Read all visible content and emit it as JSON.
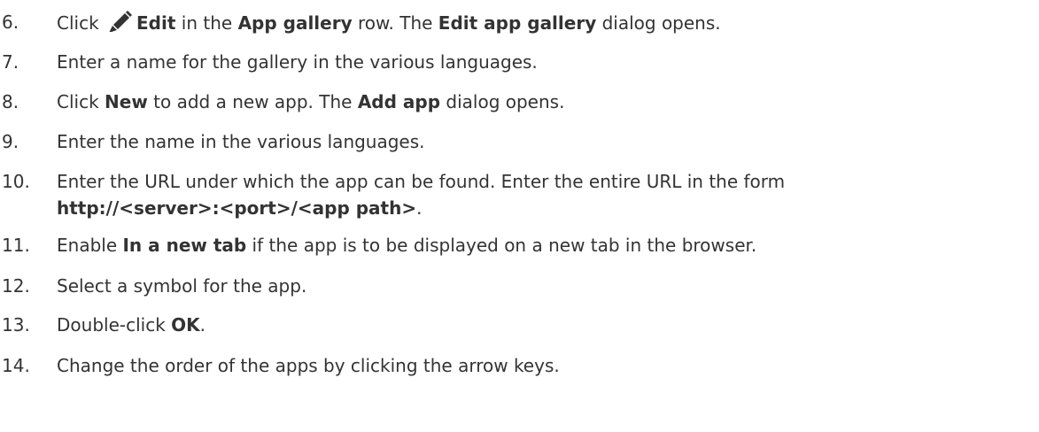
{
  "steps": [
    {
      "number": "6.",
      "parts": [
        {
          "text": "Click ",
          "bold": false
        },
        {
          "icon": "edit-pencil-icon"
        },
        {
          "text": "Edit",
          "bold": true
        },
        {
          "text": " in the ",
          "bold": false
        },
        {
          "text": "App gallery",
          "bold": true
        },
        {
          "text": " row. The ",
          "bold": false
        },
        {
          "text": "Edit app gallery",
          "bold": true
        },
        {
          "text": " dialog opens.",
          "bold": false
        }
      ]
    },
    {
      "number": "7.",
      "parts": [
        {
          "text": "Enter a name for the gallery in the various languages.",
          "bold": false
        }
      ]
    },
    {
      "number": "8.",
      "parts": [
        {
          "text": "Click ",
          "bold": false
        },
        {
          "text": "New",
          "bold": true
        },
        {
          "text": " to add a new app. The ",
          "bold": false
        },
        {
          "text": "Add app",
          "bold": true
        },
        {
          "text": " dialog opens.",
          "bold": false
        }
      ]
    },
    {
      "number": "9.",
      "parts": [
        {
          "text": "Enter the name in the various languages.",
          "bold": false
        }
      ]
    },
    {
      "number": "10.",
      "parts": [
        {
          "text": "Enter the URL under which the app can be found. Enter the entire URL in the form",
          "bold": false
        },
        {
          "break": true
        },
        {
          "text": "http://<server>:<port>/<app path>",
          "bold": true
        },
        {
          "text": ".",
          "bold": false
        }
      ]
    },
    {
      "number": "11.",
      "parts": [
        {
          "text": "Enable ",
          "bold": false
        },
        {
          "text": "In a new tab",
          "bold": true
        },
        {
          "text": " if the app is to be displayed on a new tab in the browser.",
          "bold": false
        }
      ]
    },
    {
      "number": "12.",
      "parts": [
        {
          "text": "Select a symbol for the app.",
          "bold": false
        }
      ]
    },
    {
      "number": "13.",
      "parts": [
        {
          "text": "Double-click ",
          "bold": false
        },
        {
          "text": "OK",
          "bold": true
        },
        {
          "text": ".",
          "bold": false
        }
      ]
    },
    {
      "number": "14.",
      "parts": [
        {
          "text": "Change the order of the apps by clicking the arrow keys.",
          "bold": false
        }
      ]
    }
  ]
}
